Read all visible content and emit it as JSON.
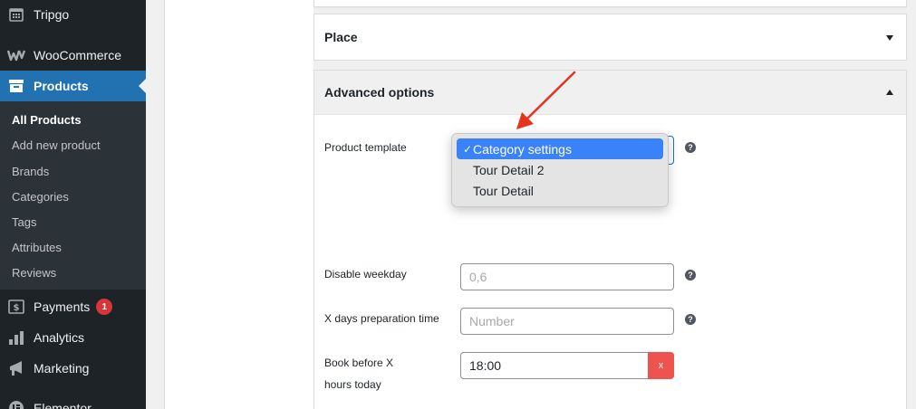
{
  "sidebar": {
    "top_item": "Tripgo",
    "items": [
      {
        "label": "WooCommerce",
        "icon": "woo-icon"
      },
      {
        "label": "Products",
        "icon": "box-icon",
        "active": true
      },
      {
        "label": "Payments",
        "icon": "dollar-icon",
        "badge": "1"
      },
      {
        "label": "Analytics",
        "icon": "bar-chart-icon"
      },
      {
        "label": "Marketing",
        "icon": "megaphone-icon"
      },
      {
        "label": "Elementor",
        "icon": "elementor-icon"
      }
    ],
    "submenu": [
      "All Products",
      "Add new product",
      "Brands",
      "Categories",
      "Tags",
      "Attributes",
      "Reviews"
    ],
    "submenu_current": "All Products"
  },
  "panels": {
    "place_title": "Place",
    "advanced_title": "Advanced options"
  },
  "fields": {
    "product_template_label": "Product template",
    "disable_weekday_label": "Disable weekday",
    "disable_weekday_placeholder": "0,6",
    "x_days_label": "X days preparation time",
    "x_days_placeholder": "Number",
    "book_before_label_1": "Book before X",
    "book_before_label_2": "hours today",
    "book_before_value": "18:00",
    "clear_label": "x",
    "help_glyph": "?"
  },
  "dropdown": {
    "options": [
      "Category settings",
      "Tour Detail 2",
      "Tour Detail"
    ],
    "selected": "Category settings",
    "check": "✓"
  },
  "colors": {
    "sidebar_bg": "#1d2327",
    "active_blue": "#2271b1",
    "badge_red": "#d63638",
    "annotation_arrow": "#e8321f",
    "selected_option": "#3a82f7"
  }
}
